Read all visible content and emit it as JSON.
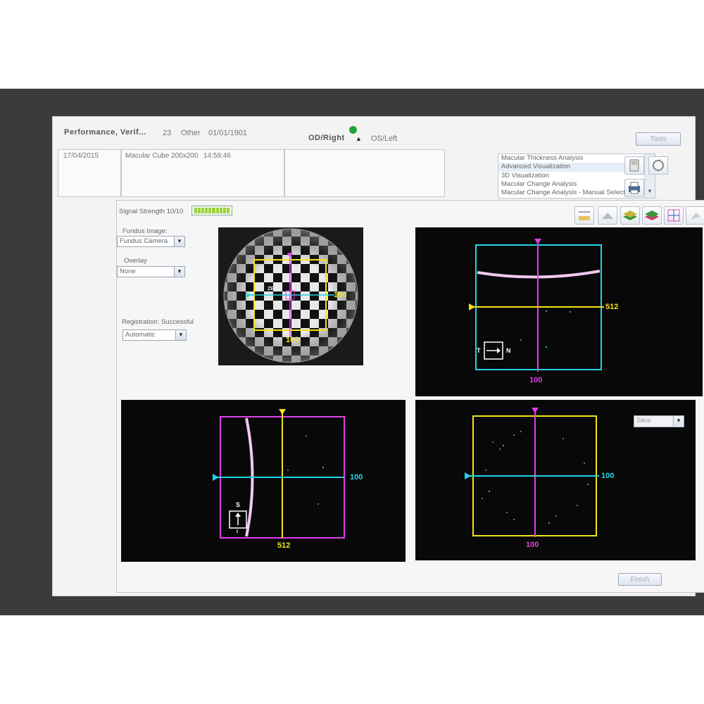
{
  "header": {
    "patient_name": "Performance, Verif...",
    "patient_id": "23",
    "gender": "Other",
    "dob": "01/01/1901",
    "od_label": "OD/Right",
    "os_label": "OS/Left",
    "tools_button": "Tools"
  },
  "exam": {
    "date": "17/04/2015",
    "scan_type": "Macular Cube 200x200",
    "scan_time": "14:58:46"
  },
  "analysis_list": {
    "items": [
      "Macular Thickness Analysis",
      "Advanced Visualization",
      "3D Visualization",
      "Macular Change Analysis",
      "Macular Change Analysis - Manual Selection"
    ],
    "selected_index": 1
  },
  "controls": {
    "signal_strength_label": "Signal Strength 10/10",
    "signal_strength_value": 10,
    "signal_strength_max": 10,
    "fundus_image_label": "Fundus Image:",
    "fundus_image_value": "Fundus Camera",
    "overlay_label": "Overlay",
    "overlay_value": "None",
    "registration_label": "Registration: Successful",
    "registration_value": "Automatic"
  },
  "fundus": {
    "brand_text": "ZEISS",
    "h_value": "100",
    "v_value": "100"
  },
  "views": {
    "top_right": {
      "right_label": "512",
      "bottom_label": "100",
      "orient_left": "T",
      "orient_right": "N"
    },
    "bottom_left": {
      "right_label": "100",
      "bottom_label": "512",
      "orient_top": "S",
      "orient_bottom": "I"
    },
    "bottom_right": {
      "right_label": "100",
      "bottom_label": "100",
      "slice_option": "Slice"
    }
  },
  "footer": {
    "finish_button": "Finish"
  },
  "colors": {
    "cyan": "#22d3e6",
    "magenta": "#e040e8",
    "yellow": "#f2e21a",
    "bg": "#080808"
  }
}
